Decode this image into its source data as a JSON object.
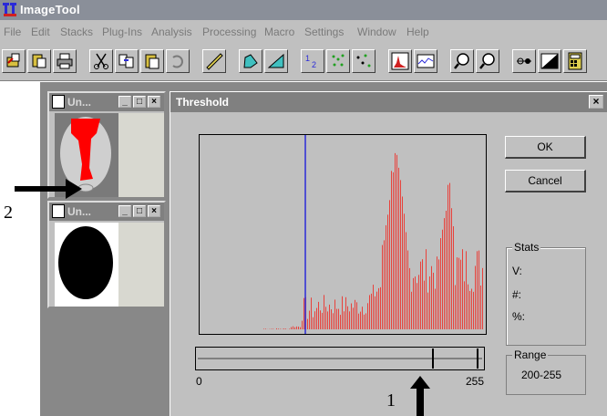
{
  "app": {
    "title": "ImageTool"
  },
  "menu": [
    "File",
    "Edit",
    "Stacks",
    "Plug-Ins",
    "Analysis",
    "Processing",
    "Macro",
    "Settings",
    "Window",
    "Help"
  ],
  "toolbar_icons": [
    "open-icon",
    "paste-icon",
    "print-icon",
    "cut-icon",
    "copy-icon",
    "clipboard-icon",
    "undo-icon",
    "ruler-icon",
    "polygon-icon",
    "angle-icon",
    "count-icon",
    "scatter-icon",
    "points-icon",
    "histogram-icon",
    "profile-icon",
    "zoom-in-icon",
    "zoom-out-icon",
    "contrast-icon",
    "invert-icon",
    "calculator-icon"
  ],
  "child_windows": [
    {
      "title": "Un..."
    },
    {
      "title": "Un..."
    }
  ],
  "dialog": {
    "title": "Threshold",
    "ok_label": "OK",
    "cancel_label": "Cancel",
    "stats": {
      "legend": "Stats",
      "v_label": "V:",
      "count_label": "#:",
      "percent_label": "%:"
    },
    "range": {
      "legend": "Range",
      "value": "200-255"
    },
    "slider": {
      "min_label": "0",
      "max_label": "255",
      "lower": 200,
      "upper": 255
    }
  },
  "annotations": {
    "label_1": "1",
    "label_2": "2"
  },
  "colors": {
    "histogram": "#e8413b",
    "marker_line": "#2a2ad8",
    "threshold_overlay": "#ff0000"
  }
}
